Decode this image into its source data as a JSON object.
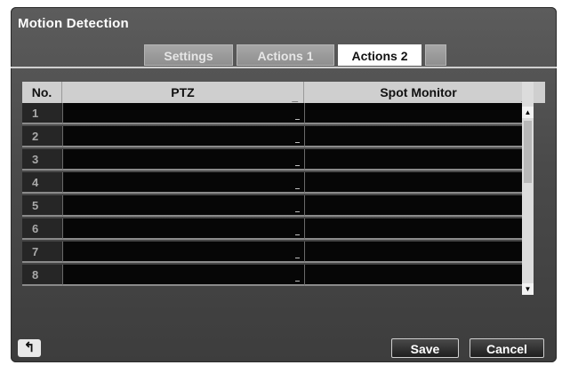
{
  "window": {
    "title": "Motion Detection"
  },
  "tabs": [
    {
      "label": "Settings",
      "active": false
    },
    {
      "label": "Actions 1",
      "active": false
    },
    {
      "label": "Actions 2",
      "active": true
    },
    {
      "label": "",
      "active": false
    }
  ],
  "table": {
    "columns": [
      "No.",
      "PTZ",
      "Spot Monitor"
    ],
    "rows": [
      {
        "no": "1",
        "ptz": "",
        "spot_monitor": ""
      },
      {
        "no": "2",
        "ptz": "",
        "spot_monitor": ""
      },
      {
        "no": "3",
        "ptz": "",
        "spot_monitor": ""
      },
      {
        "no": "4",
        "ptz": "",
        "spot_monitor": ""
      },
      {
        "no": "5",
        "ptz": "",
        "spot_monitor": ""
      },
      {
        "no": "6",
        "ptz": "",
        "spot_monitor": ""
      },
      {
        "no": "7",
        "ptz": "",
        "spot_monitor": ""
      },
      {
        "no": "8",
        "ptz": "",
        "spot_monitor": ""
      }
    ]
  },
  "icons": {
    "back": "back-arrow-icon",
    "scroll_up": "triangle-up-icon",
    "scroll_down": "triangle-down-icon"
  },
  "footer": {
    "save_label": "Save",
    "cancel_label": "Cancel"
  },
  "colors": {
    "active_tab": "#ffffff",
    "cell_background": "#060606",
    "header_background": "#cfcfcf"
  }
}
